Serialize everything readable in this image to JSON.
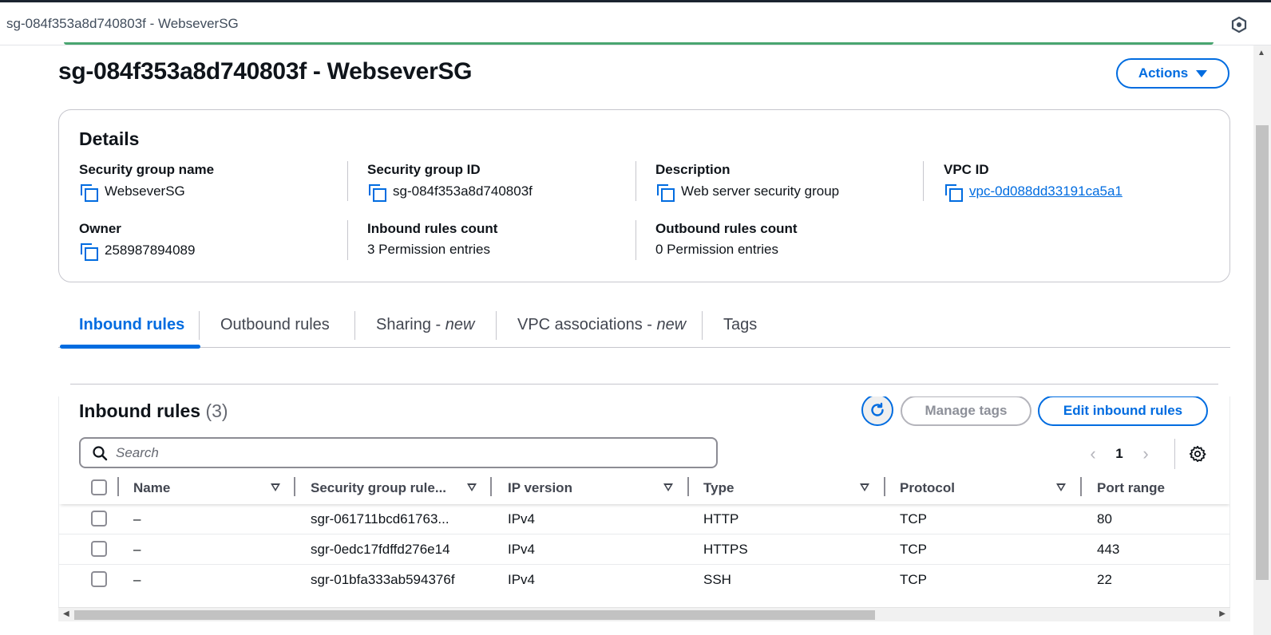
{
  "window": {
    "title": "sg-084f353a8d740803f - WebseverSG"
  },
  "header": {
    "title": "sg-084f353a8d740803f - WebseverSG",
    "actions_label": "Actions"
  },
  "details": {
    "heading": "Details",
    "fields": {
      "sg_name": {
        "label": "Security group name",
        "value": "WebseverSG"
      },
      "sg_id": {
        "label": "Security group ID",
        "value": "sg-084f353a8d740803f"
      },
      "description": {
        "label": "Description",
        "value": "Web server security group"
      },
      "vpc_id": {
        "label": "VPC ID",
        "value": "vpc-0d088dd33191ca5a1"
      },
      "owner": {
        "label": "Owner",
        "value": "258987894089"
      },
      "inbound_count": {
        "label": "Inbound rules count",
        "value": "3 Permission entries"
      },
      "outbound_count": {
        "label": "Outbound rules count",
        "value": "0 Permission entries"
      }
    }
  },
  "tabs": [
    {
      "label": "Inbound rules",
      "suffix": "",
      "active": true
    },
    {
      "label": "Outbound rules",
      "suffix": ""
    },
    {
      "label": "Sharing - ",
      "suffix": "new"
    },
    {
      "label": "VPC associations - ",
      "suffix": "new"
    },
    {
      "label": "Tags",
      "suffix": ""
    }
  ],
  "inbound": {
    "heading": "Inbound rules",
    "count": "(3)",
    "manage_tags_label": "Manage tags",
    "edit_label": "Edit inbound rules",
    "search_placeholder": "Search",
    "page": "1",
    "columns": [
      "Name",
      "Security group rule...",
      "IP version",
      "Type",
      "Protocol",
      "Port range"
    ],
    "rows": [
      {
        "name": "–",
        "rule_id": "sgr-061711bcd61763...",
        "ip_version": "IPv4",
        "type": "HTTP",
        "protocol": "TCP",
        "port_range": "80"
      },
      {
        "name": "–",
        "rule_id": "sgr-0edc17fdffd276e14",
        "ip_version": "IPv4",
        "type": "HTTPS",
        "protocol": "TCP",
        "port_range": "443"
      },
      {
        "name": "–",
        "rule_id": "sgr-01bfa333ab594376f",
        "ip_version": "IPv4",
        "type": "SSH",
        "protocol": "TCP",
        "port_range": "22"
      }
    ]
  },
  "colors": {
    "accent": "#006ce0",
    "text": "#0f141a",
    "border": "#c6c6cd",
    "muted": "#8d9099"
  },
  "icons": [
    "copy-icon",
    "refresh-icon",
    "search-icon",
    "gear-icon",
    "caret-down-icon",
    "chevron-left-icon",
    "chevron-right-icon",
    "sort-icon",
    "extension-icon"
  ]
}
